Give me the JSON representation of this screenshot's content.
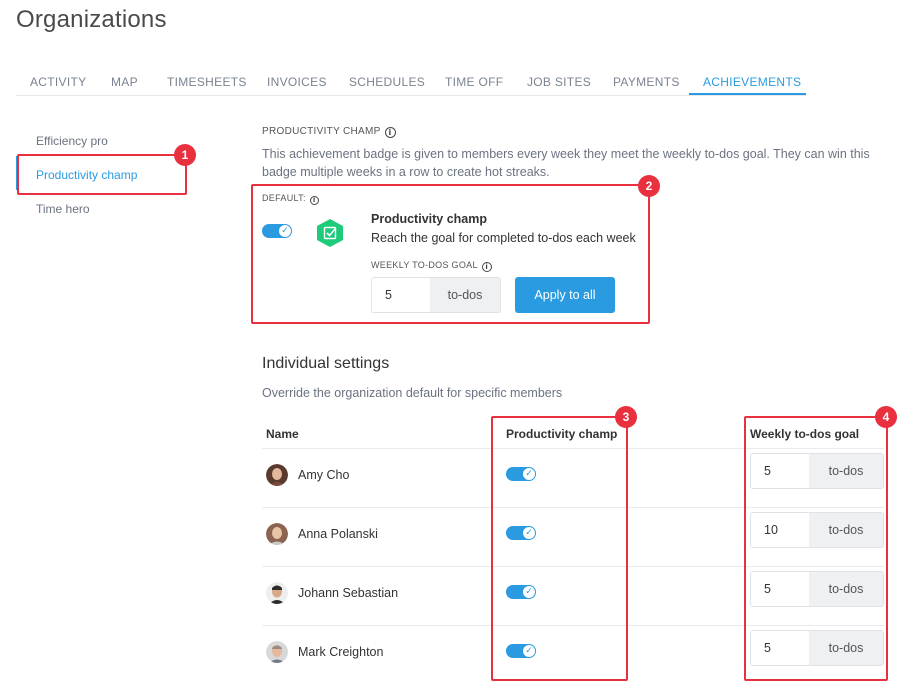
{
  "page": {
    "title": "Organizations"
  },
  "tabs": [
    {
      "label": "ACTIVITY"
    },
    {
      "label": "MAP"
    },
    {
      "label": "TIMESHEETS"
    },
    {
      "label": "INVOICES"
    },
    {
      "label": "SCHEDULES"
    },
    {
      "label": "TIME OFF"
    },
    {
      "label": "JOB SITES"
    },
    {
      "label": "PAYMENTS"
    },
    {
      "label": "ACHIEVEMENTS",
      "active": true
    }
  ],
  "sidebar": {
    "items": [
      {
        "label": "Efficiency pro"
      },
      {
        "label": "Productivity champ",
        "active": true
      },
      {
        "label": "Time hero"
      }
    ]
  },
  "badges": [
    "1",
    "2",
    "3",
    "4"
  ],
  "achievement": {
    "section_label": "PRODUCTIVITY CHAMP",
    "description": "This achievement badge is given to members every week they meet the weekly to-dos goal. They can win this badge multiple weeks in a row to create hot streaks.",
    "default_label": "DEFAULT:",
    "default_enabled": true,
    "title": "Productivity champ",
    "subtitle": "Reach the goal for completed to-dos each week",
    "goal_label": "WEEKLY TO-DOS GOAL",
    "goal_value": "5",
    "goal_unit": "to-dos",
    "apply_label": "Apply to all",
    "badge_color": "#1ecb7a"
  },
  "individual": {
    "title": "Individual settings",
    "subtitle": "Override the organization default for specific members",
    "columns": {
      "name": "Name",
      "toggle": "Productivity champ",
      "goal": "Weekly to-dos goal"
    },
    "members": [
      {
        "name": "Amy Cho",
        "enabled": true,
        "goal": "5",
        "unit": "to-dos"
      },
      {
        "name": "Anna Polanski",
        "enabled": true,
        "goal": "10",
        "unit": "to-dos"
      },
      {
        "name": "Johann Sebastian",
        "enabled": true,
        "goal": "5",
        "unit": "to-dos"
      },
      {
        "name": "Mark Creighton",
        "enabled": true,
        "goal": "5",
        "unit": "to-dos"
      }
    ]
  },
  "colors": {
    "accent": "#2a9be0",
    "highlight": "#e8303e"
  }
}
